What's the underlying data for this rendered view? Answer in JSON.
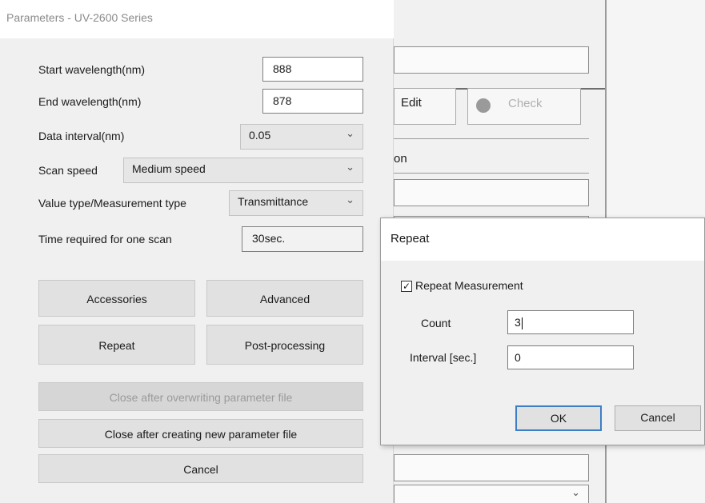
{
  "params": {
    "title": "Parameters - UV-2600 Series",
    "start_wavelength": {
      "label": "Start wavelength(nm)",
      "value": "888"
    },
    "end_wavelength": {
      "label": "End wavelength(nm)",
      "value": "878"
    },
    "data_interval": {
      "label": "Data interval(nm)",
      "value": "0.05"
    },
    "scan_speed": {
      "label": "Scan speed",
      "value": "Medium speed"
    },
    "value_type": {
      "label": "Value type/Measurement type",
      "value": "Transmittance"
    },
    "time_required": {
      "label": "Time required for one scan",
      "value": "30sec."
    },
    "buttons": {
      "accessories": "Accessories",
      "advanced": "Advanced",
      "repeat": "Repeat",
      "post_processing": "Post-processing",
      "close_overwrite": "Close after overwriting parameter file",
      "close_new": "Close after creating new parameter file",
      "cancel": "Cancel"
    }
  },
  "background": {
    "edit_label": "Edit",
    "check_label": "Check",
    "partial_label": "on"
  },
  "repeat_dialog": {
    "title": "Repeat",
    "repeat_measurement": {
      "label": "Repeat Measurement",
      "checked": true
    },
    "count": {
      "label": "Count",
      "value": "3"
    },
    "interval": {
      "label": "Interval [sec.]",
      "value": "0"
    },
    "ok_label": "OK",
    "cancel_label": "Cancel"
  },
  "colors": {
    "default_button_border": "#3c7fc6",
    "dialog_bg": "#f0f0f0"
  },
  "icons": {
    "combo_dropdown": "chevron-down-icon",
    "check": "checkbox-checked-icon",
    "info": "info-circle-icon"
  }
}
